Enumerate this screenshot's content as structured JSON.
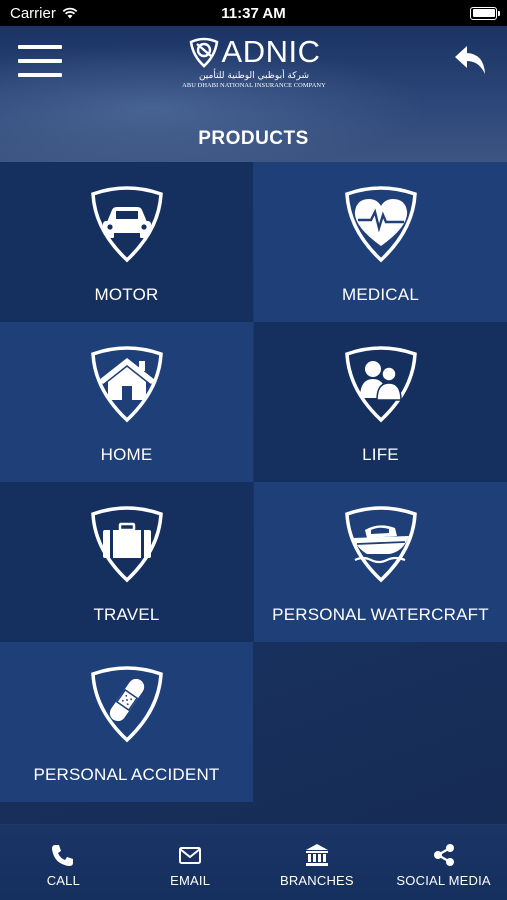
{
  "status_bar": {
    "carrier": "Carrier",
    "time": "11:37 AM"
  },
  "header": {
    "logo_text": "ADNIC",
    "logo_arabic": "شركة أبوظبي الوطنية للتأمين",
    "logo_english": "ABU DHABI NATIONAL INSURANCE COMPANY",
    "title": "PRODUCTS"
  },
  "products": [
    {
      "label": "MOTOR",
      "icon": "car-icon"
    },
    {
      "label": "MEDICAL",
      "icon": "heart-pulse-icon"
    },
    {
      "label": "HOME",
      "icon": "house-icon"
    },
    {
      "label": "LIFE",
      "icon": "family-icon"
    },
    {
      "label": "TRAVEL",
      "icon": "suitcase-icon"
    },
    {
      "label": "PERSONAL WATERCRAFT",
      "icon": "boat-icon"
    },
    {
      "label": "PERSONAL ACCIDENT",
      "icon": "bandage-icon"
    }
  ],
  "bottom_nav": [
    {
      "label": "CALL",
      "icon": "phone-icon"
    },
    {
      "label": "EMAIL",
      "icon": "envelope-icon"
    },
    {
      "label": "BRANCHES",
      "icon": "bank-icon"
    },
    {
      "label": "SOCIAL MEDIA",
      "icon": "share-icon"
    }
  ],
  "colors": {
    "tile_dark": "#15305f",
    "tile_light": "#1e3f77",
    "text": "#ffffff"
  }
}
